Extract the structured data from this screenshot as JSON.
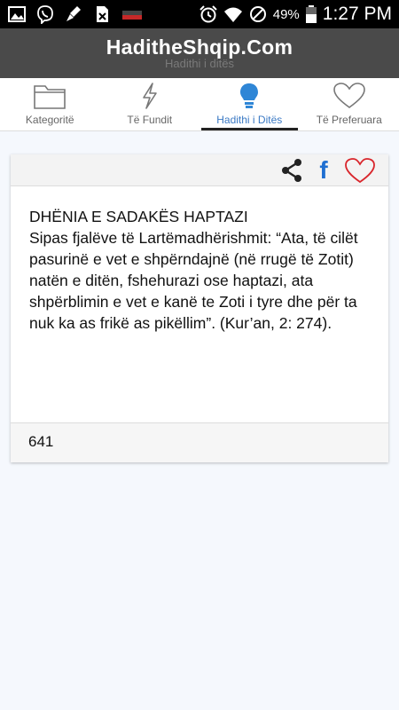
{
  "status_bar": {
    "battery": "49%",
    "time": "1:27 PM",
    "left_icons": [
      "image-icon",
      "viber-icon",
      "cleaner-icon",
      "sim-icon",
      "battery-bar-icon"
    ],
    "right_icons": [
      "alarm-icon",
      "wifi-icon",
      "blocked-icon",
      "battery-icon"
    ]
  },
  "header": {
    "title": "HaditheShqip.Com",
    "subtitle": "Hadithi i ditës"
  },
  "tabs": [
    {
      "label": "Kategoritë",
      "icon": "folder-icon"
    },
    {
      "label": "Të Fundit",
      "icon": "lightning-icon"
    },
    {
      "label": "Hadithi i Ditës",
      "icon": "lightbulb-icon",
      "active": true
    },
    {
      "label": "Të Preferuara",
      "icon": "heart-outline-icon"
    }
  ],
  "card": {
    "actions": {
      "share": "share-icon",
      "facebook": "f",
      "favorite": "heart-icon"
    },
    "title": "DHËNIA E SADAKËS HAPTAZI",
    "text": "Sipas fjalëve të Lartëmadhërishmit: “Ata, të cilët pasurinë e vet e shpërndajnë (në rrugë të Zotit) natën e ditën, fshehurazi ose haptazi, ata shpërblimin e vet e kanë te Zoti i tyre dhe për ta nuk ka as frikë as pikëllim”. (Kur’an, 2: 274).",
    "number": "641"
  },
  "colors": {
    "header_bg": "#4a4a4a",
    "active_tab": "#3a79c4",
    "facebook": "#1f6fd1",
    "heart": "#d9262c",
    "page_bg": "#f5f8fd"
  }
}
